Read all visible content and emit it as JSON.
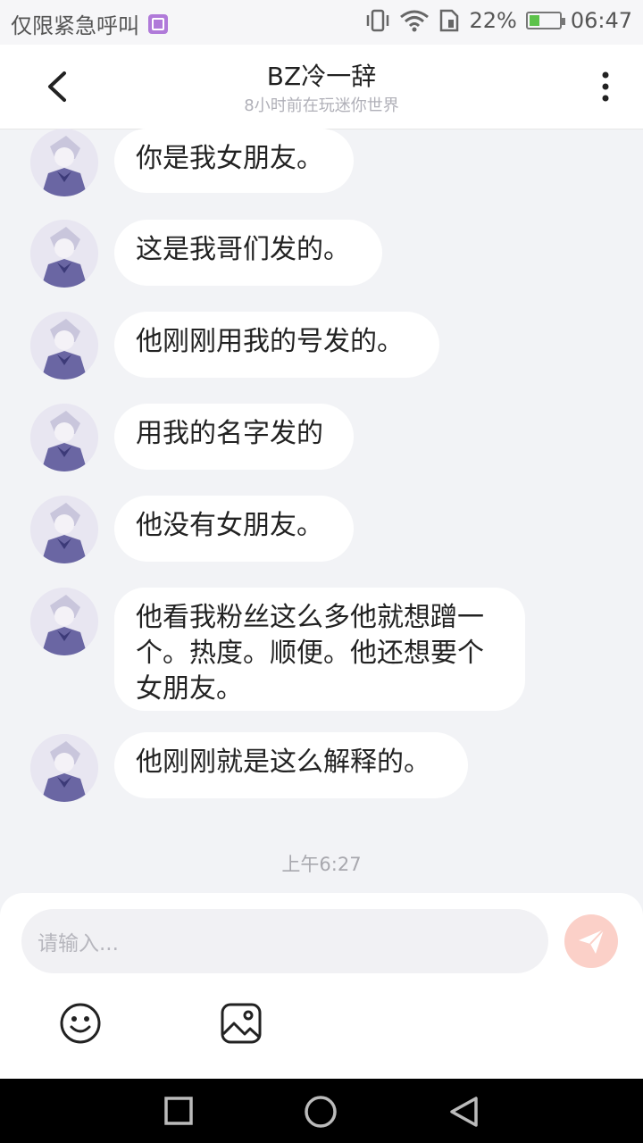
{
  "status_bar": {
    "carrier": "仅限紧急呼叫",
    "battery_percent": "22%",
    "time": "06:47",
    "icons": [
      "gallery-icon",
      "vibrate-icon",
      "wifi-icon",
      "sim-icon",
      "battery-icon"
    ]
  },
  "header": {
    "title": "BZ冷一辞",
    "subtitle": "8小时前在玩迷你世界",
    "back_icon": "chevron-left-icon",
    "more_icon": "more-vertical-icon"
  },
  "messages": [
    {
      "text": "你是我女朋友。"
    },
    {
      "text": "这是我哥们发的。"
    },
    {
      "text": "他刚刚用我的号发的。"
    },
    {
      "text": "用我的名字发的"
    },
    {
      "text": "他没有女朋友。"
    },
    {
      "text": "他看我粉丝这么多他就想蹭一个。热度。顺便。他还想要个女朋友。"
    },
    {
      "text": "他刚刚就是这么解释的。"
    }
  ],
  "timestamp": "上午6:27",
  "input": {
    "placeholder": "请输入..."
  },
  "toolbar": {
    "emoji_icon": "emoji-icon",
    "image_icon": "image-icon",
    "send_icon": "send-icon"
  },
  "colors": {
    "background": "#f2f3f6",
    "bubble": "#ffffff",
    "send_accent": "#f5a596"
  }
}
